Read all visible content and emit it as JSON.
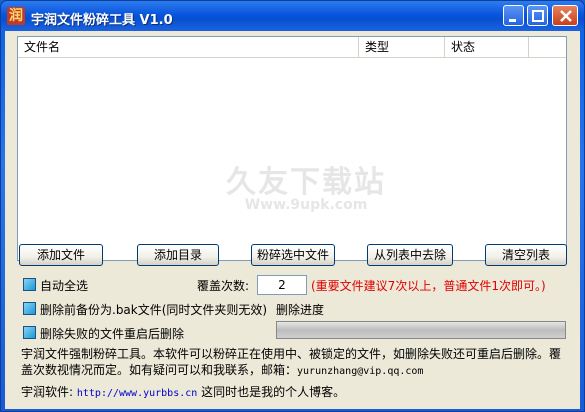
{
  "window": {
    "title": "宇润文件粉碎工具 V1.0",
    "icon_char": "润"
  },
  "listview": {
    "columns": [
      "文件名",
      "类型",
      "状态",
      ""
    ],
    "rows": []
  },
  "watermark": {
    "main": "久友下载站",
    "url": "Www.9upk.com"
  },
  "buttons": {
    "add_file": "添加文件",
    "add_dir": "添加目录",
    "shred_selected": "粉碎选中文件",
    "remove_from_list": "从列表中去除",
    "clear_list": "清空列表"
  },
  "options": {
    "auto_select_all": "自动全选",
    "overwrite_label": "覆盖次数:",
    "overwrite_value": "2",
    "overwrite_hint": "(重要文件建议7次以上，普通文件1次即可。)",
    "backup_before_delete": "删除前备份为.bak文件(同时文件夹则无效)",
    "progress_label": "删除进度",
    "progress_value": 0,
    "restart_delete_failed": "删除失败的文件重启后删除"
  },
  "description": {
    "line1": "宇润文件强制粉碎工具。本软件可以粉碎正在使用中、被锁定的文件，如删除失败还可重启后删除。覆盖次数视情况而定。如有疑问可以和我联系，邮箱：",
    "email": "yurunzhang@vip.qq.com"
  },
  "footer": {
    "prefix": "宇润软件:",
    "url": "http://www.yurbbs.cn",
    "suffix": "这同时也是我的个人博客。"
  },
  "colors": {
    "titlebar": "#0855dd",
    "client": "#ece9d8",
    "warning": "#e00000",
    "link": "#0000cc"
  }
}
